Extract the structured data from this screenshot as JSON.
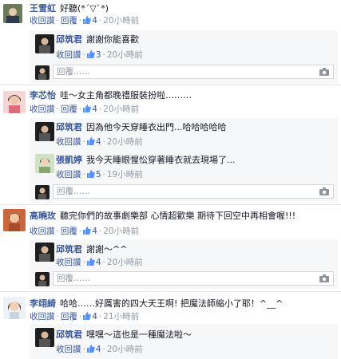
{
  "labels": {
    "reply": "收回讚",
    "respond": "回覆",
    "reply_placeholder": "回覆……",
    "time": "20小時前",
    "time19": "19小時前",
    "time21": "21小時前",
    "sep": "·"
  },
  "threads": [
    {
      "author": "王雪虹",
      "text": "好聽(*´▽`*)",
      "likes": "4",
      "time": "20小時前",
      "replies": [
        {
          "author": "邱筑君",
          "text": "謝謝你能喜歡",
          "likes": "3",
          "time": "20小時前"
        }
      ]
    },
    {
      "author": "李芯怡",
      "text": "哇～女主角都晚禮服裝扮啦………",
      "likes": "4",
      "time": "20小時前",
      "replies": [
        {
          "author": "邱筑君",
          "text": "因為他今天穿睡衣出門...哈哈哈哈哈",
          "likes": "4",
          "time": "20小時前"
        },
        {
          "author": "張凱婷",
          "text": "我今天睡眼惺忪穿著睡衣就去現場了...",
          "likes": "5",
          "time": "19小時前"
        }
      ]
    },
    {
      "author": "高曉玫",
      "text": "聽完你們的故事劇樂部 心情超歡樂 期待下回空中再相會喔!!!",
      "likes": "4",
      "time": "20小時前",
      "replies": [
        {
          "author": "邱筑君",
          "text": "謝謝～^^",
          "likes": "4",
          "time": "20小時前"
        }
      ]
    },
    {
      "author": "李翊綺",
      "text": "哈哈……好厲害的四大天王啊! 把魔法師縮小了耶！^__^",
      "likes": "4",
      "time": "21小時前",
      "replies": [
        {
          "author": "邱筑君",
          "text": "嘿嘿～這也是一種魔法啦～",
          "likes": "4",
          "time": "20小時前"
        }
      ]
    }
  ],
  "colors": {
    "link": "#3b5998",
    "meta": "#9197a3",
    "panel": "#f6f7f8"
  }
}
